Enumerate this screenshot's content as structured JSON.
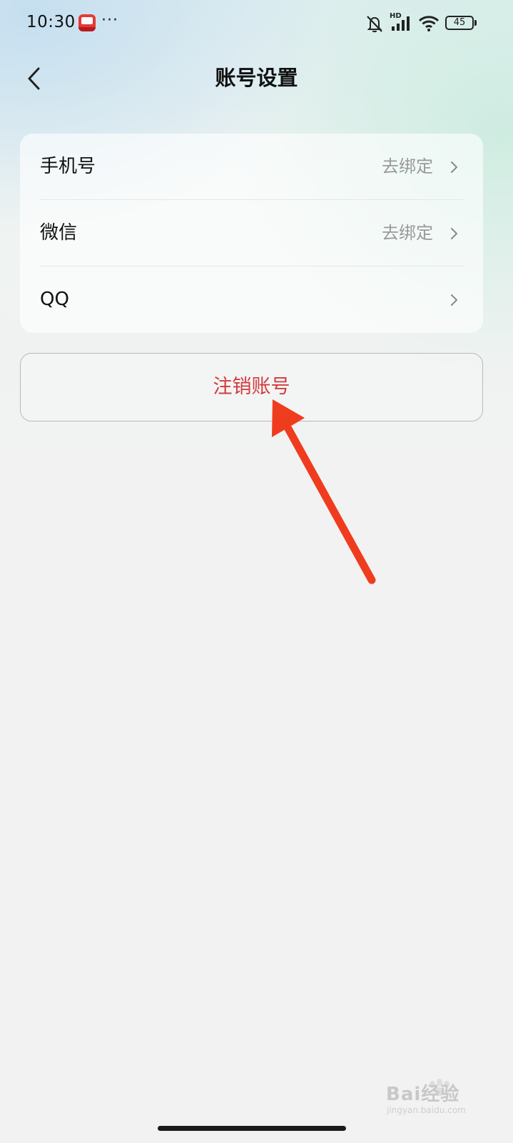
{
  "status_bar": {
    "time": "10:30",
    "more": "···",
    "network_label": "HD",
    "battery": "45",
    "icons": [
      "app-notification-icon",
      "more-icon",
      "bell-muted-icon",
      "signal-icon",
      "wifi-icon",
      "battery-icon"
    ]
  },
  "header": {
    "title": "账号设置",
    "back_icon": "chevron-left-icon"
  },
  "settings": {
    "items": [
      {
        "label": "手机号",
        "value": "去绑定"
      },
      {
        "label": "微信",
        "value": "去绑定"
      },
      {
        "label": "QQ",
        "value": ""
      }
    ]
  },
  "deactivate": {
    "label": "注销账号"
  },
  "watermark": {
    "text": "Bai经验",
    "sub": "jingyan.baidu.com"
  },
  "colors": {
    "danger": "#d33b3b",
    "annotation_arrow": "#f03c1e",
    "secondary_text": "#999999"
  }
}
